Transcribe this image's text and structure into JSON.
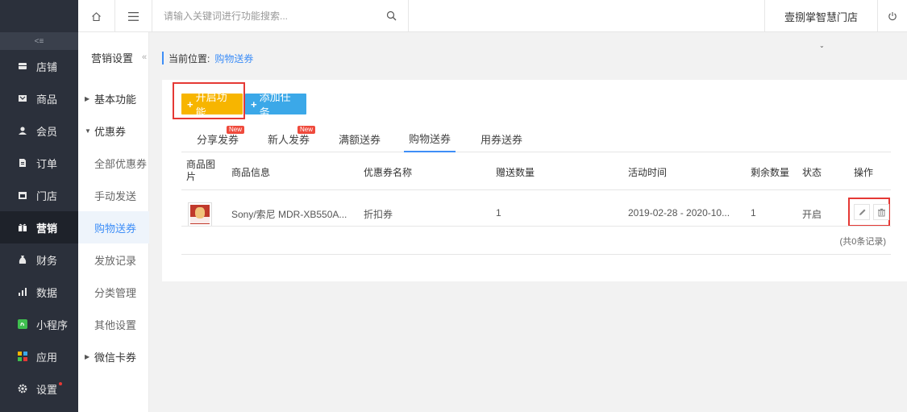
{
  "sidebar": {
    "items": [
      {
        "label": "店铺",
        "icon": "store-icon"
      },
      {
        "label": "商品",
        "icon": "goods-icon"
      },
      {
        "label": "会员",
        "icon": "member-icon"
      },
      {
        "label": "订单",
        "icon": "order-icon"
      },
      {
        "label": "门店",
        "icon": "shop-icon"
      },
      {
        "label": "营销",
        "icon": "gift-icon"
      },
      {
        "label": "财务",
        "icon": "money-bag-icon"
      },
      {
        "label": "数据",
        "icon": "bar-chart-icon"
      },
      {
        "label": "小程序",
        "icon": "miniprogram-icon"
      },
      {
        "label": "应用",
        "icon": "apps-icon"
      },
      {
        "label": "设置",
        "icon": "gear-icon"
      }
    ]
  },
  "topbar": {
    "search_placeholder": "请输入关键词进行功能搜索...",
    "store_name": "壹捌掌智慧门店"
  },
  "subsidebar": {
    "title": "营销设置",
    "items": [
      {
        "label": "基本功能"
      },
      {
        "label": "优惠券"
      },
      {
        "label": "全部优惠券"
      },
      {
        "label": "手动发送"
      },
      {
        "label": "购物送券"
      },
      {
        "label": "发放记录"
      },
      {
        "label": "分类管理"
      },
      {
        "label": "其他设置"
      },
      {
        "label": "微信卡券"
      }
    ]
  },
  "breadcrumb": {
    "prefix": "当前位置:",
    "current": "购物送券"
  },
  "actions": {
    "enable_label": "开启功能",
    "add_task_label": "添加任务"
  },
  "tabs": [
    {
      "label": "分享发券",
      "badge": "New"
    },
    {
      "label": "新人发券",
      "badge": "New"
    },
    {
      "label": "满额送券"
    },
    {
      "label": "购物送券"
    },
    {
      "label": "用券送券"
    }
  ],
  "table": {
    "headers": {
      "image_line1": "商品图",
      "image_line2": "片",
      "info": "商品信息",
      "coupon_name": "优惠券名称",
      "gift_count": "赠送数量",
      "time": "活动时间",
      "remaining": "剩余数量",
      "status": "状态",
      "ops": "操作"
    },
    "rows": [
      {
        "info": "Sony/索尼 MDR-XB550A...",
        "coupon_name": "折扣券",
        "gift_count": "1",
        "time": "2019-02-28 - 2020-10...",
        "remaining": "1",
        "status": "开启"
      }
    ],
    "total": "(共0条记录)"
  }
}
